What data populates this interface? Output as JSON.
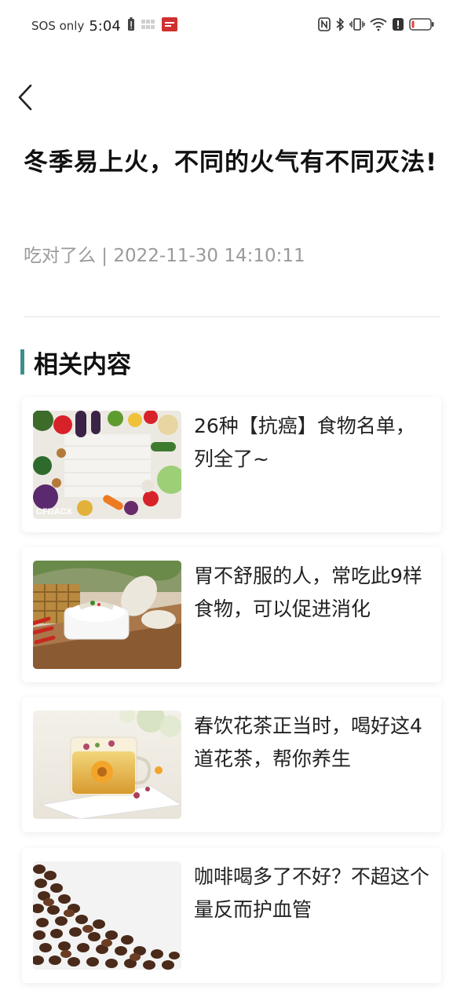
{
  "status_bar": {
    "carrier": "SOS only",
    "time": "5:04"
  },
  "article": {
    "title": "冬季易上火，不同的火气有不同灭法!",
    "meta": "吃对了么 | 2022-11-30 14:10:11"
  },
  "related": {
    "heading": "相关内容",
    "accent_color": "#3f8f8a",
    "items": [
      {
        "title": "26种【抗癌】食物名单，列全了~",
        "thumb_label": "CFDACX",
        "thumb": "vegetables-image"
      },
      {
        "title": "胃不舒服的人，常吃此9样食物，可以促进消化",
        "thumb": "yam-dish-image"
      },
      {
        "title": "春饮花茶正当时，喝好这4道花茶，帮你养生",
        "thumb": "flower-tea-image"
      },
      {
        "title": "咖啡喝多了不好？不超这个量反而护血管",
        "thumb": "coffee-beans-image"
      }
    ]
  }
}
